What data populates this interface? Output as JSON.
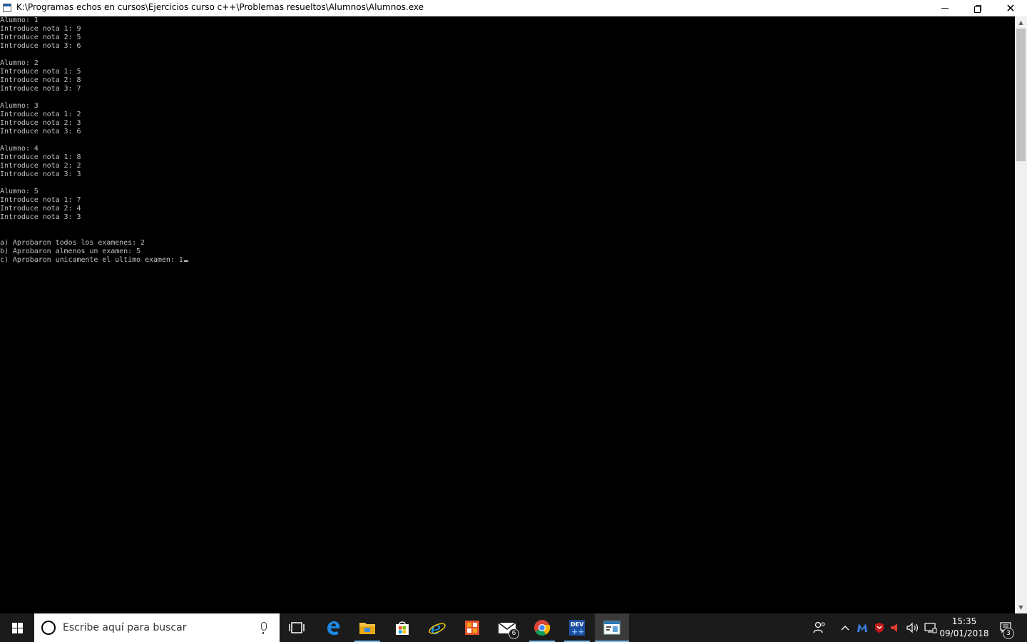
{
  "window": {
    "title": "K:\\Programas echos en cursos\\Ejercicios curso c++\\Problemas resueltos\\Alumnos\\Alumnos.exe",
    "minimize_glyph": "—",
    "close_glyph": "✕"
  },
  "console": {
    "lines": [
      "Alumno: 1",
      "Introduce nota 1: 9",
      "Introduce nota 2: 5",
      "Introduce nota 3: 6",
      "",
      "Alumno: 2",
      "Introduce nota 1: 5",
      "Introduce nota 2: 8",
      "Introduce nota 3: 7",
      "",
      "Alumno: 3",
      "Introduce nota 1: 2",
      "Introduce nota 2: 3",
      "Introduce nota 3: 6",
      "",
      "Alumno: 4",
      "Introduce nota 1: 8",
      "Introduce nota 2: 2",
      "Introduce nota 3: 3",
      "",
      "Alumno: 5",
      "Introduce nota 1: 7",
      "Introduce nota 2: 4",
      "Introduce nota 3: 3",
      "",
      "",
      "a) Aprobaron todos los examenes: 2",
      "b) Aprobaron almenos un examen: 5",
      "c) Aprobaron unicamente el ultimo examen: 1"
    ],
    "text_color": "#c0c0c0",
    "background": "#000000"
  },
  "scrollbar": {
    "up_glyph": "▲",
    "down_glyph": "▼"
  },
  "taskbar": {
    "search_placeholder": "Escribe aquí para buscar",
    "mail_badge": "6",
    "dev_label": "DEV",
    "clock_time": "15:35",
    "clock_date": "09/01/2018",
    "notification_count": "3",
    "accent": "#76b9ed"
  }
}
